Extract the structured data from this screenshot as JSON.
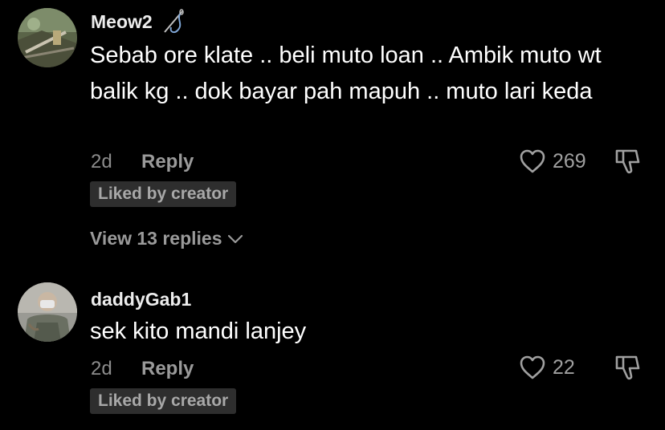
{
  "comments": [
    {
      "username": "Meow2",
      "text": "Sebab ore klate .. beli muto loan .. Ambik muto wt balik kg .. dok bayar pah mapuh .. muto lari keda",
      "time": "2d",
      "reply_label": "Reply",
      "likes": "269",
      "liked_by_creator": "Liked by creator",
      "view_replies": "View 13 replies",
      "badge_icon": "needle-thread-icon"
    },
    {
      "username": "daddyGab1",
      "text": "sek kito mandi lanjey",
      "time": "2d",
      "reply_label": "Reply",
      "likes": "22",
      "liked_by_creator": "Liked by creator"
    }
  ],
  "colors": {
    "background": "#000000",
    "text": "#ffffff",
    "muted": "#8c8c8c",
    "badge_bg": "#2e2e2e"
  }
}
